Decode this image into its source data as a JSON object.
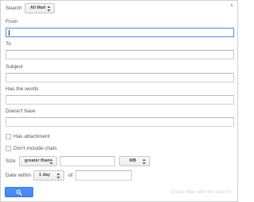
{
  "header": {
    "search_label": "Search",
    "scope_value": "All Mail",
    "close_glyph": "×"
  },
  "fields": {
    "from_label": "From",
    "from_value": "",
    "to_label": "To",
    "to_value": "",
    "subject_label": "Subject",
    "subject_value": "",
    "has_words_label": "Has the words",
    "has_words_value": "",
    "doesnt_have_label": "Doesn't have",
    "doesnt_have_value": ""
  },
  "checkboxes": {
    "has_attachment_label": "Has attachment",
    "has_attachment_checked": false,
    "dont_include_chats_label": "Don't include chats",
    "dont_include_chats_checked": false
  },
  "size": {
    "label": "Size",
    "operator_value": "greater than",
    "amount_value": "",
    "unit_value": "MB"
  },
  "date": {
    "label": "Date within",
    "range_value": "1 day",
    "of_label": "of",
    "of_value": ""
  },
  "actions": {
    "search_icon": "search-icon",
    "create_filter_label": "Create filter with this search »"
  },
  "colors": {
    "accent": "#4d90fe",
    "focus_border": "#4d90fe",
    "muted_link": "#c8d4e8"
  }
}
